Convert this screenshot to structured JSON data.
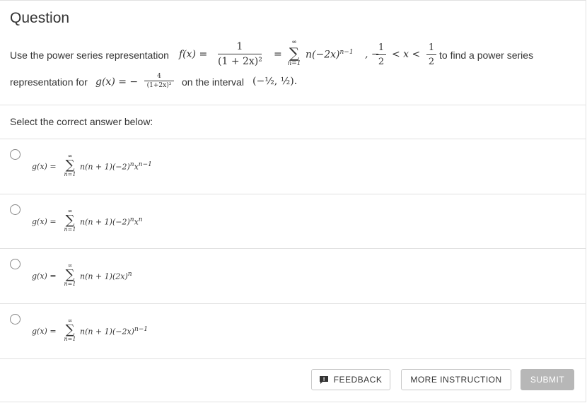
{
  "header": {
    "title": "Question"
  },
  "question": {
    "line1_prefix": "Use the power series representation",
    "f_lhs": "f(x) =",
    "f_num": "1",
    "f_den": "(1 + 2x)²",
    "eq": "=",
    "sum_top": "∞",
    "sum_bot": "n=1",
    "sum_term": "n(−2x)",
    "sum_exp": "n−1",
    "interval_minus": ",  −",
    "half_num": "1",
    "half_den": "2",
    "ineq": "< x <",
    "line1_suffix": "to find a power series",
    "line2_prefix": "representation for",
    "g_lhs": "g(x) = −",
    "g_num": "4",
    "g_den": "(1+2x)³",
    "interval_text": "on the interval",
    "interval_math": "(−½, ½)."
  },
  "prompt": "Select the correct answer below:",
  "options": [
    {
      "lhs": "g(x) =",
      "sum_top": "∞",
      "sum_bot": "n=1",
      "term": "n(n + 1)(−2)",
      "sup1": "n",
      "var": "x",
      "sup2": "n−1"
    },
    {
      "lhs": "g(x) =",
      "sum_top": "∞",
      "sum_bot": "n=1",
      "term": "n(n + 1)(−2)",
      "sup1": "n",
      "var": "x",
      "sup2": "n"
    },
    {
      "lhs": "g(x) =",
      "sum_top": "∞",
      "sum_bot": "n=1",
      "term": "n(n + 1)(2x)",
      "sup1": "n",
      "var": "",
      "sup2": ""
    },
    {
      "lhs": "g(x) =",
      "sum_top": "∞",
      "sum_bot": "n=1",
      "term": "n(n + 1)(−2x)",
      "sup1": "n−1",
      "var": "",
      "sup2": ""
    }
  ],
  "buttons": {
    "feedback": "FEEDBACK",
    "more_instruction": "MORE INSTRUCTION",
    "submit": "SUBMIT"
  },
  "icons": {
    "feedback": "feedback-flag-icon"
  },
  "colors": {
    "submit_bg": "#b7b7b7",
    "border": "#e1e1e1",
    "text": "#333333"
  }
}
